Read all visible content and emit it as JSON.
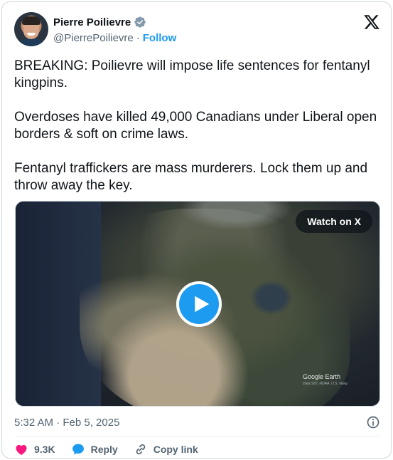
{
  "author": {
    "display_name": "Pierre Poilievre",
    "handle": "@PierrePoilievre",
    "separator": "·",
    "follow_label": "Follow"
  },
  "tweet": {
    "paragraphs": [
      "BREAKING: Poilievre will impose life sentences for fentanyl kingpins.",
      "Overdoses have killed 49,000 Canadians under Liberal open borders & soft on crime laws.",
      "Fentanyl traffickers are mass murderers. Lock them up and throw away the key."
    ]
  },
  "media": {
    "watch_label": "Watch on X",
    "watermark": "Google Earth",
    "credit": "Data SIO, NOAA, U.S. Navy"
  },
  "meta": {
    "timestamp": "5:32 AM · Feb 5, 2025"
  },
  "actions": {
    "like_count": "9.3K",
    "reply_label": "Reply",
    "copy_link_label": "Copy link"
  },
  "colors": {
    "accent": "#1d9bf0",
    "like": "#f91880",
    "secondary_text": "#536471"
  },
  "icons": [
    "verified-badge-icon",
    "x-logo-icon",
    "play-icon",
    "info-icon",
    "heart-icon",
    "reply-icon",
    "link-icon"
  ]
}
